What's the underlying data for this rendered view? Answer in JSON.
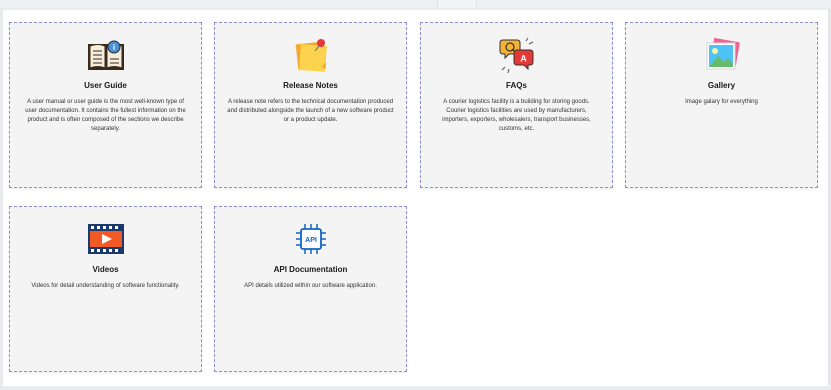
{
  "cards": [
    {
      "title": "User Guide",
      "icon": "book-icon",
      "description": "A user manual or user guide is the most well-known type of user documentation. It contains the fullest information on the product and is often composed of the sections we describe separately."
    },
    {
      "title": "Release Notes",
      "icon": "sticky-note-icon",
      "description": "A release note refers to the technical documentation produced and distributed alongside the launch of a new software product or a product update."
    },
    {
      "title": "FAQs",
      "icon": "qa-bubbles-icon",
      "description": "A courier logistics facility is a building for storing goods. Courier logistics facilities are used by manufacturers, importers, exporters, wholesalers, transport businesses, customs, etc."
    },
    {
      "title": "Gallery",
      "icon": "image-gallery-icon",
      "description": "Image galary for everything"
    },
    {
      "title": "Videos",
      "icon": "video-film-icon",
      "description": "Videos for detail understanding of software functionality."
    },
    {
      "title": "API Documentation",
      "icon": "api-chip-icon",
      "description": "API details utilized within our software application."
    }
  ],
  "colors": {
    "card_border": "#8d8fd6",
    "card_bg": "#f4f4f4",
    "accent_blue": "#1565c0",
    "accent_orange": "#f15a24"
  }
}
